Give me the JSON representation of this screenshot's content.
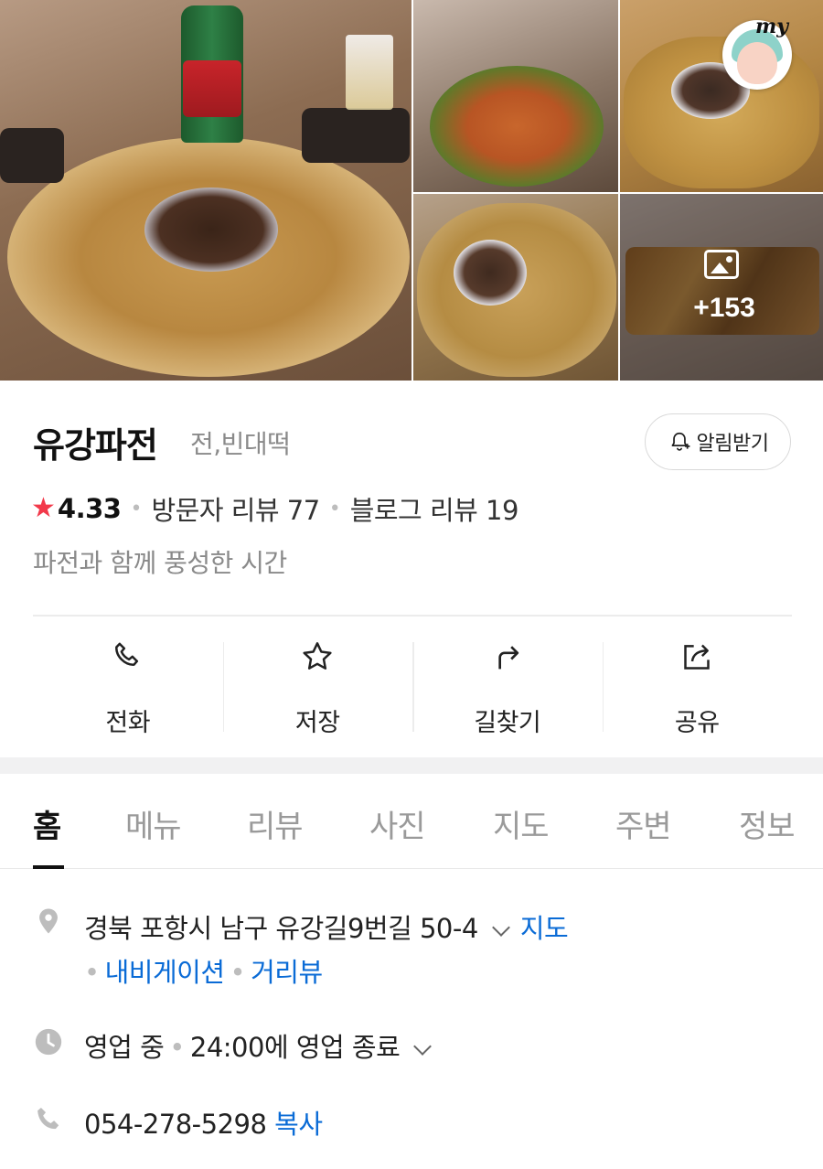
{
  "gallery": {
    "more_count": "+153",
    "my_label": "my"
  },
  "place": {
    "name": "유강파전",
    "category": "전,빈대떡",
    "alarm_label": "알림받기",
    "rating": "4.33",
    "visitor_reviews": "방문자 리뷰 77",
    "blog_reviews": "블로그 리뷰 19",
    "tagline": "파전과 함께 풍성한 시간"
  },
  "actions": [
    {
      "label": "전화",
      "icon": "phone-icon"
    },
    {
      "label": "저장",
      "icon": "star-icon"
    },
    {
      "label": "길찾기",
      "icon": "directions-icon"
    },
    {
      "label": "공유",
      "icon": "share-icon"
    }
  ],
  "tabs": [
    "홈",
    "메뉴",
    "리뷰",
    "사진",
    "지도",
    "주변",
    "정보"
  ],
  "active_tab": "홈",
  "info": {
    "address": "경북 포항시 남구 유강길9번길 50-4",
    "map_link": "지도",
    "navigation_link": "내비게이션",
    "streetview_link": "거리뷰",
    "status": "영업 중",
    "hours": "24:00에 영업 종료",
    "phone": "054-278-5298",
    "copy_link": "복사"
  },
  "colors": {
    "accent_star": "#f2394a",
    "link_blue": "#0a6bd6"
  }
}
